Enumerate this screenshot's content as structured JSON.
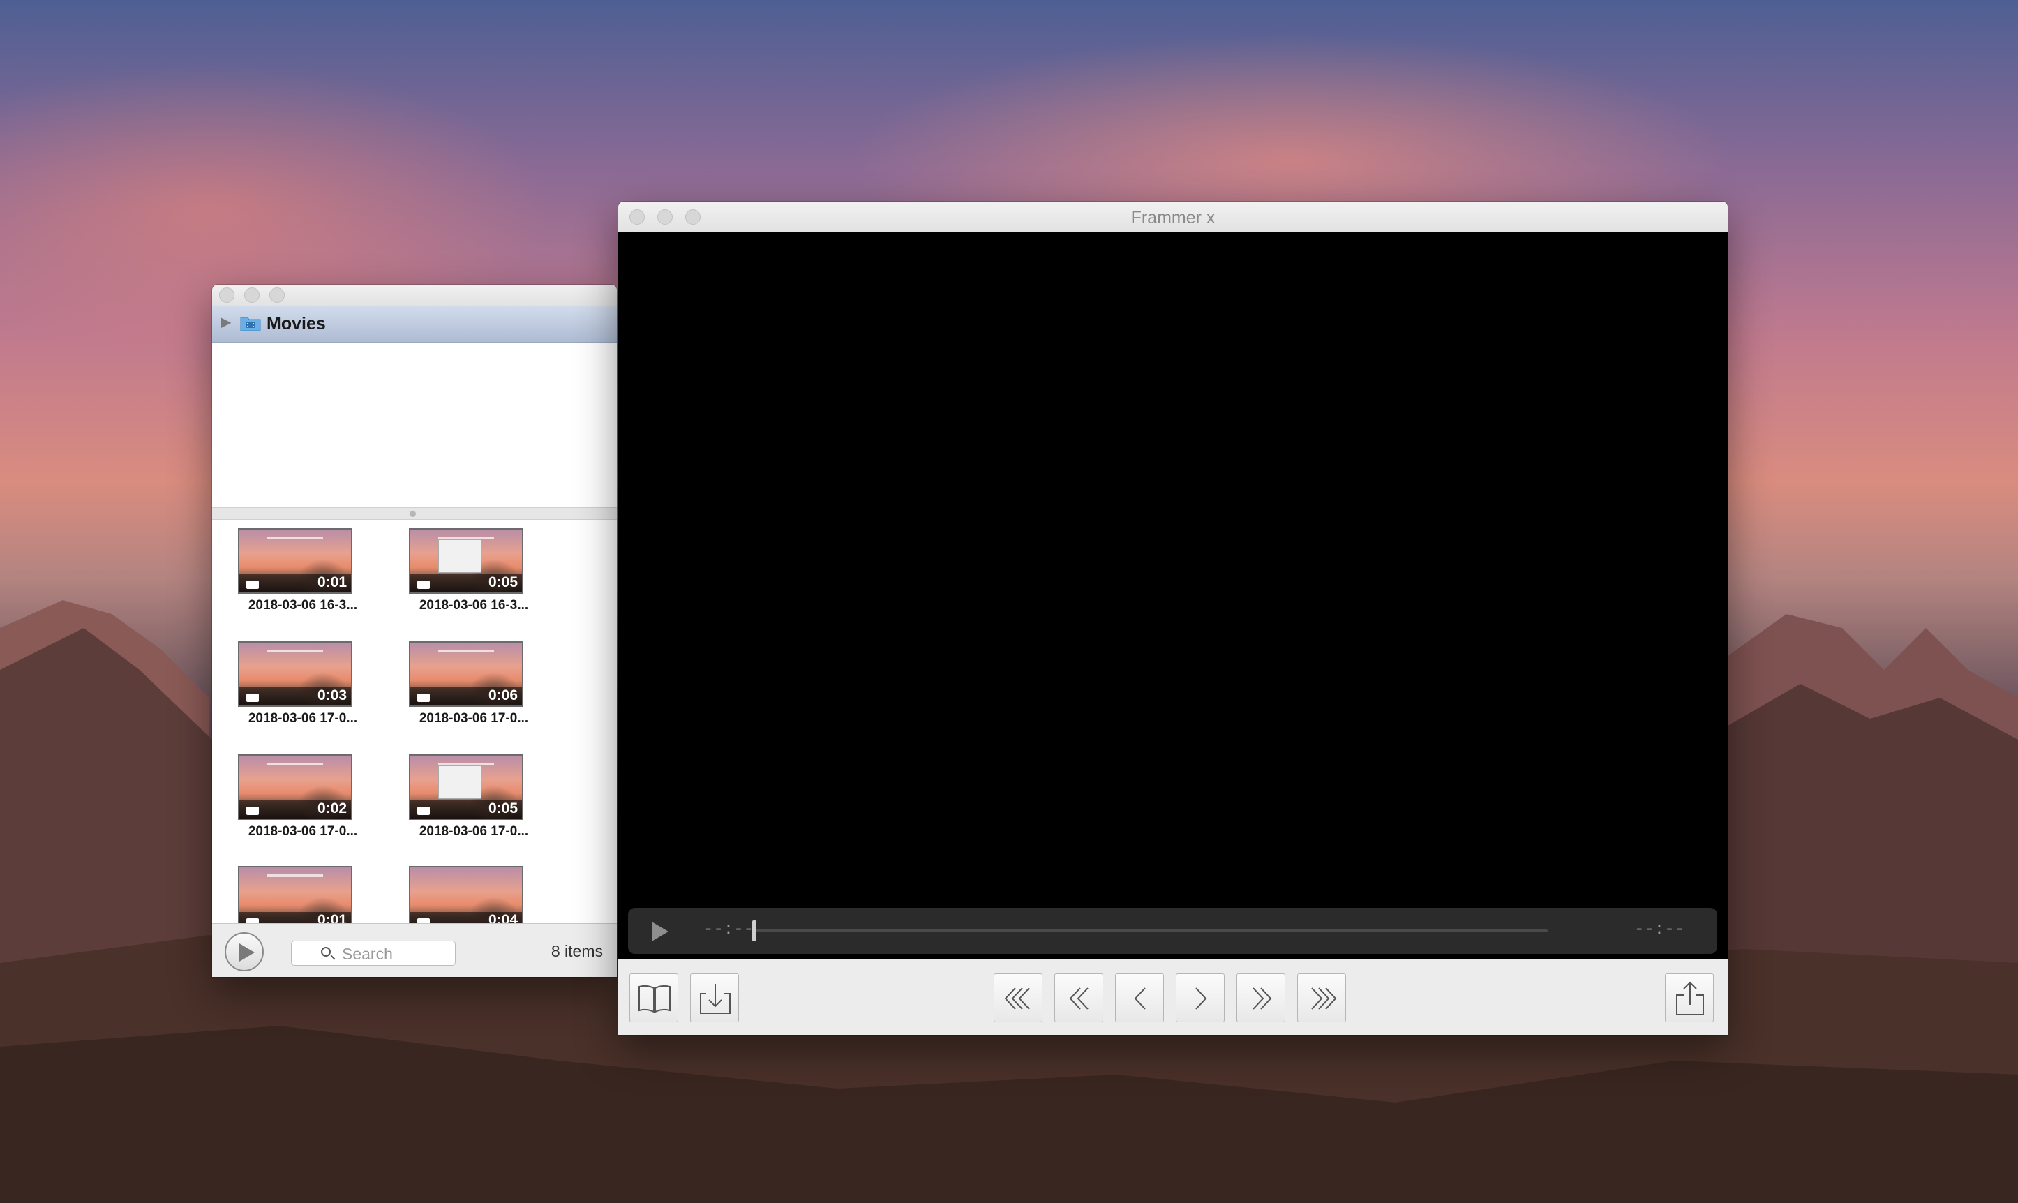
{
  "browser": {
    "folder": {
      "name": "Movies",
      "icon": "movies-folder-icon"
    },
    "items": [
      {
        "label": "2018-03-06 16-3...",
        "duration": "0:01",
        "thumb": "plain"
      },
      {
        "label": "2018-03-06 16-3...",
        "duration": "0:05",
        "thumb": "dialog"
      },
      {
        "label": "2018-03-06 17-0...",
        "duration": "0:03",
        "thumb": "plain"
      },
      {
        "label": "2018-03-06 17-0...",
        "duration": "0:06",
        "thumb": "plain"
      },
      {
        "label": "2018-03-06 17-0...",
        "duration": "0:02",
        "thumb": "plain"
      },
      {
        "label": "2018-03-06 17-0...",
        "duration": "0:05",
        "thumb": "dialog"
      },
      {
        "label": "",
        "duration": "0:01",
        "thumb": "plain"
      },
      {
        "label": "",
        "duration": "0:04",
        "thumb": "plain"
      }
    ],
    "search": {
      "placeholder": "Search",
      "value": ""
    },
    "item_count": "8 items"
  },
  "player": {
    "title": "Frammer x",
    "elapsed": "--:--",
    "remaining": "--:--",
    "toolbar_icons": {
      "left": [
        "book-icon",
        "import-icon"
      ],
      "center": [
        "skip-to-start-icon",
        "fast-rewind-icon",
        "step-back-icon",
        "step-forward-icon",
        "fast-forward-icon",
        "skip-to-end-icon"
      ],
      "right": [
        "share-icon"
      ]
    }
  },
  "colors": {
    "video_bg": "#000000",
    "folder_bar": "#b8c4da",
    "window_bg": "#ececec"
  }
}
